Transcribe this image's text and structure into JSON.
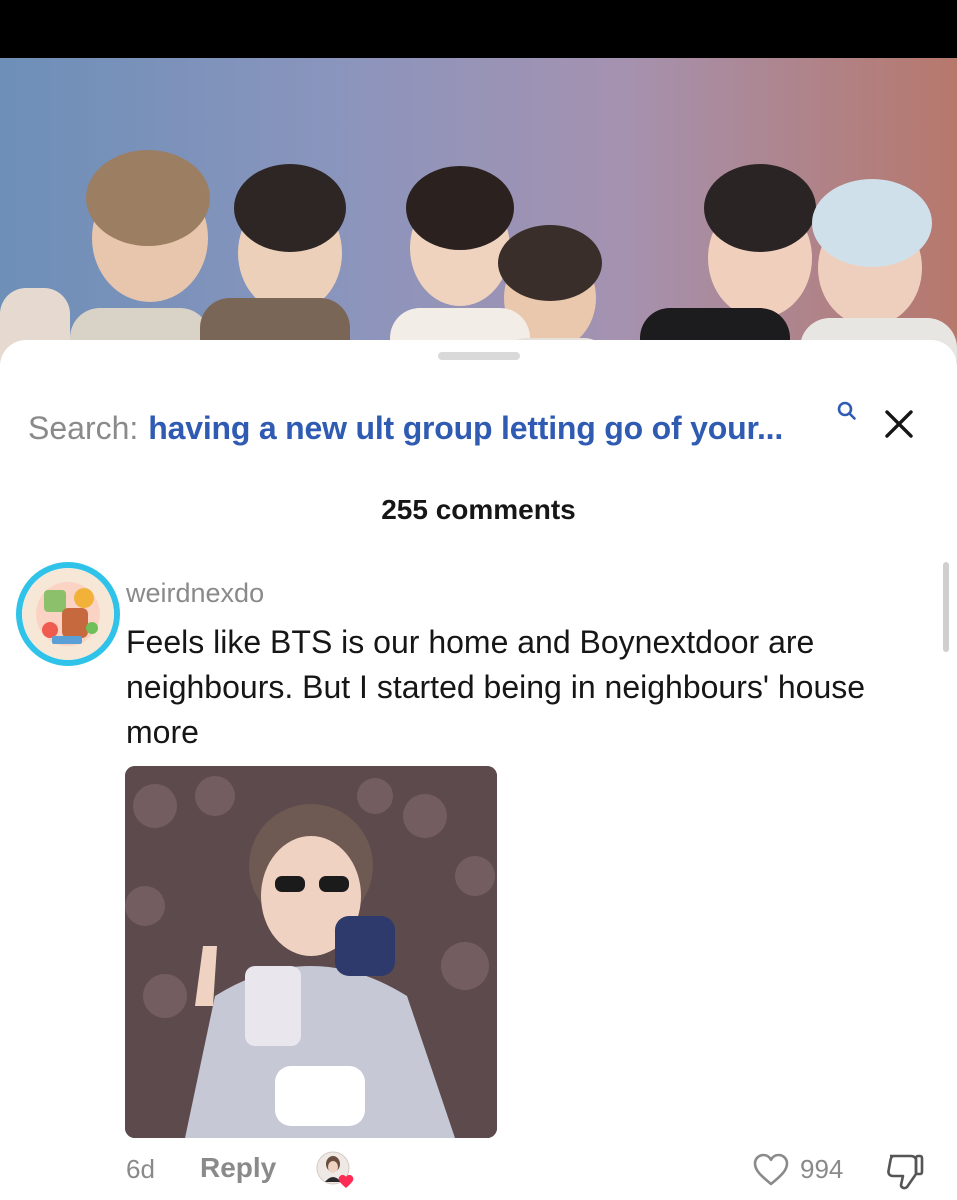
{
  "search": {
    "prefix": "Search:",
    "query": "having a new ult group letting go of your..."
  },
  "comments_header": {
    "count_label": "255 comments"
  },
  "comment": {
    "username": "weirdnexdo",
    "text": "Feels like BTS is our home and Boynextdoor are neighbours. But I started being in neighbours' house more",
    "time": "6d",
    "reply_label": "Reply",
    "like_count": "994"
  },
  "colors": {
    "search_query": "#2f5bb3",
    "avatar_ring": "#2fc3ea",
    "creator_heart": "#fe2c55"
  },
  "icons": [
    "search-icon",
    "close-icon",
    "heart-outline-icon",
    "thumbs-down-icon",
    "creator-liked-icon"
  ]
}
